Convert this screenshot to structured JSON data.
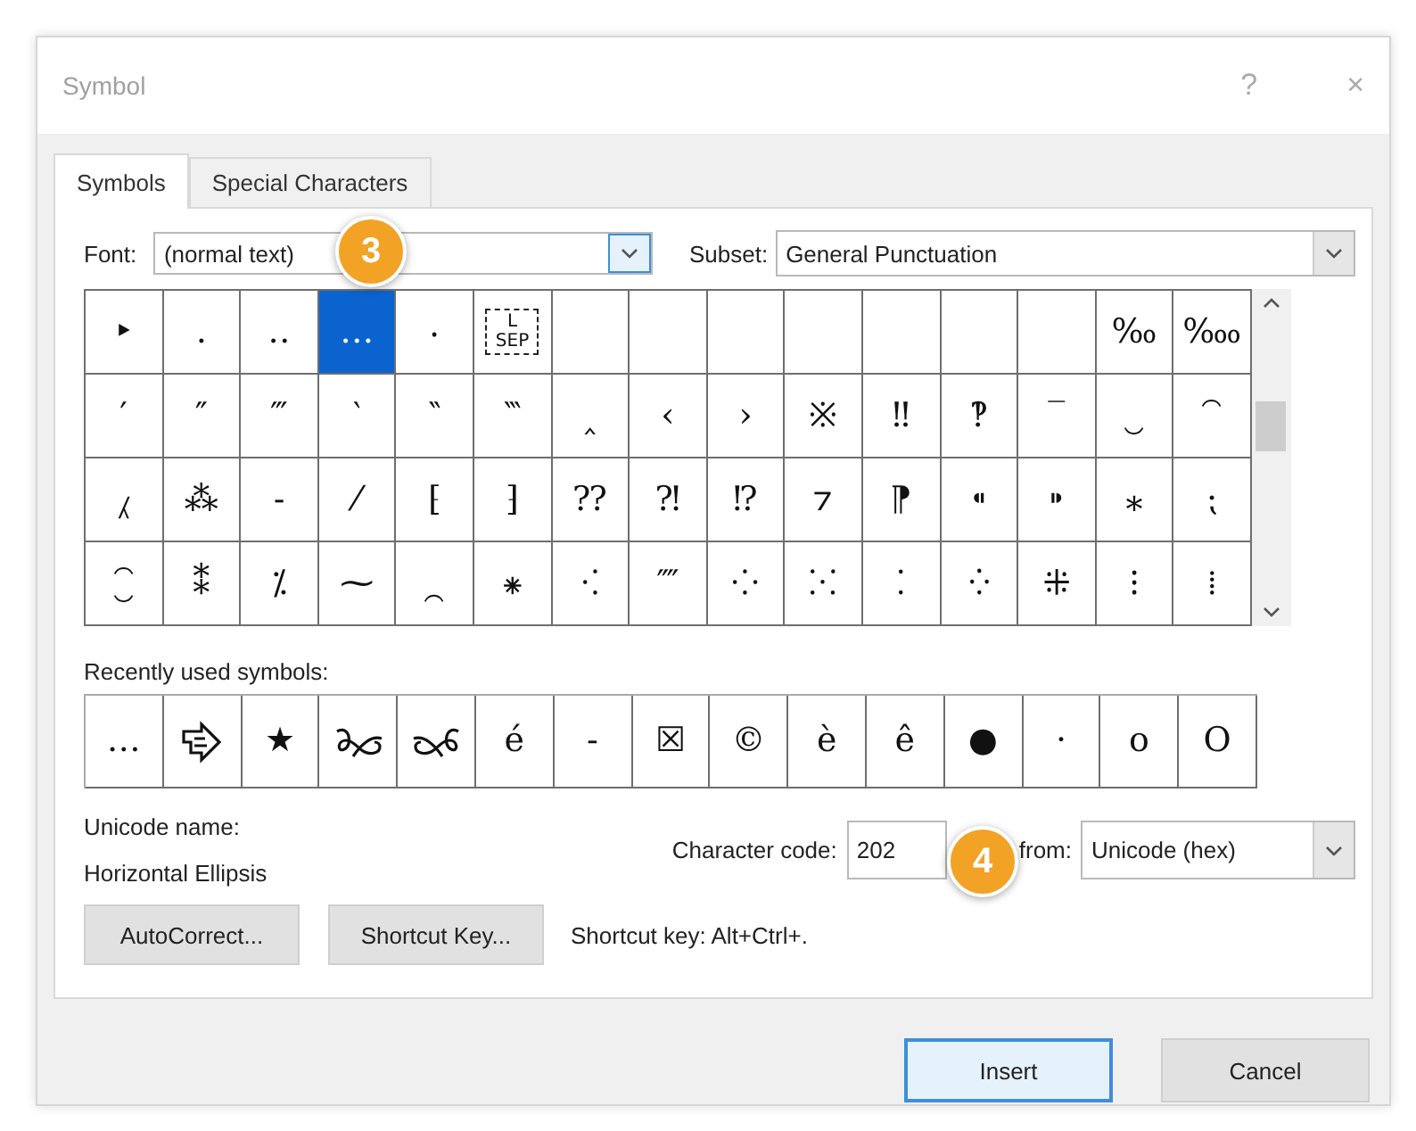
{
  "window": {
    "title": "Symbol",
    "help_button": "?",
    "close_button": "×"
  },
  "tabs": [
    {
      "label": "Symbols",
      "selected": true
    },
    {
      "label": "Special Characters",
      "selected": false
    }
  ],
  "font": {
    "label": "Font:",
    "value": "(normal text)"
  },
  "subset": {
    "label": "Subset:",
    "value": "General Punctuation"
  },
  "symbol_grid": {
    "rows": [
      [
        {
          "kind": "glyph",
          "char": "‣",
          "selected": false
        },
        {
          "kind": "glyph",
          "char": "․",
          "selected": false
        },
        {
          "kind": "glyph",
          "char": "‥",
          "selected": false
        },
        {
          "kind": "glyph",
          "char": "…",
          "selected": true
        },
        {
          "kind": "glyph",
          "char": "‧",
          "selected": false
        },
        {
          "kind": "control-picture",
          "char": "L SEP",
          "selected": false
        },
        {
          "kind": "blank",
          "selected": false
        },
        {
          "kind": "blank",
          "selected": false
        },
        {
          "kind": "blank",
          "selected": false
        },
        {
          "kind": "blank",
          "selected": false
        },
        {
          "kind": "blank",
          "selected": false
        },
        {
          "kind": "blank",
          "selected": false
        },
        {
          "kind": "blank",
          "selected": false
        },
        {
          "kind": "glyph",
          "char": "‰",
          "selected": false
        },
        {
          "kind": "glyph",
          "char": "‱",
          "selected": false
        }
      ],
      [
        {
          "kind": "glyph",
          "char": "′",
          "selected": false
        },
        {
          "kind": "glyph",
          "char": "″",
          "selected": false
        },
        {
          "kind": "glyph",
          "char": "‴",
          "selected": false
        },
        {
          "kind": "glyph",
          "char": "‵",
          "selected": false
        },
        {
          "kind": "glyph",
          "char": "‶",
          "selected": false
        },
        {
          "kind": "glyph",
          "char": "‷",
          "selected": false
        },
        {
          "kind": "glyph",
          "char": "‸",
          "selected": false
        },
        {
          "kind": "glyph",
          "char": "‹",
          "selected": false
        },
        {
          "kind": "glyph",
          "char": "›",
          "selected": false
        },
        {
          "kind": "glyph",
          "char": "※",
          "selected": false
        },
        {
          "kind": "glyph",
          "char": "‼",
          "selected": false
        },
        {
          "kind": "glyph",
          "char": "‽",
          "selected": false
        },
        {
          "kind": "glyph",
          "char": "‾",
          "selected": false
        },
        {
          "kind": "glyph",
          "char": "‿",
          "selected": false
        },
        {
          "kind": "glyph",
          "char": "⁀",
          "selected": false
        }
      ],
      [
        {
          "kind": "glyph",
          "char": "⁁",
          "selected": false
        },
        {
          "kind": "glyph",
          "char": "⁂",
          "selected": false
        },
        {
          "kind": "glyph",
          "char": "⁃",
          "selected": false
        },
        {
          "kind": "glyph",
          "char": "⁄",
          "selected": false
        },
        {
          "kind": "glyph",
          "char": "⁅",
          "selected": false
        },
        {
          "kind": "glyph",
          "char": "⁆",
          "selected": false
        },
        {
          "kind": "glyph",
          "char": "⁇",
          "selected": false
        },
        {
          "kind": "glyph",
          "char": "⁈",
          "selected": false
        },
        {
          "kind": "glyph",
          "char": "⁉",
          "selected": false
        },
        {
          "kind": "glyph",
          "char": "⁊",
          "selected": false
        },
        {
          "kind": "glyph",
          "char": "⁋",
          "selected": false
        },
        {
          "kind": "glyph",
          "char": "⁌",
          "selected": false
        },
        {
          "kind": "glyph",
          "char": "⁍",
          "selected": false
        },
        {
          "kind": "glyph",
          "char": "⁎",
          "selected": false
        },
        {
          "kind": "glyph",
          "char": "⁏",
          "selected": false
        }
      ],
      [
        {
          "kind": "glyph",
          "char": "⁐",
          "selected": false
        },
        {
          "kind": "glyph",
          "char": "⁑",
          "selected": false
        },
        {
          "kind": "glyph",
          "char": "⁒",
          "selected": false
        },
        {
          "kind": "glyph",
          "char": "⁓",
          "selected": false
        },
        {
          "kind": "glyph",
          "char": "⁔",
          "selected": false
        },
        {
          "kind": "glyph",
          "char": "⁕",
          "selected": false
        },
        {
          "kind": "glyph",
          "char": "⁖",
          "selected": false
        },
        {
          "kind": "glyph",
          "char": "⁗",
          "selected": false
        },
        {
          "kind": "glyph",
          "char": "⁘",
          "selected": false
        },
        {
          "kind": "glyph",
          "char": "⁙",
          "selected": false
        },
        {
          "kind": "glyph",
          "char": "⁚",
          "selected": false
        },
        {
          "kind": "glyph",
          "char": "⁛",
          "selected": false
        },
        {
          "kind": "glyph",
          "char": "⁜",
          "selected": false
        },
        {
          "kind": "glyph",
          "char": "⁝",
          "selected": false
        },
        {
          "kind": "glyph",
          "char": "⁞",
          "selected": false
        }
      ]
    ]
  },
  "recent": {
    "label": "Recently used symbols:",
    "items": [
      {
        "kind": "glyph",
        "char": "…",
        "selected": false
      },
      {
        "kind": "arrow-tag",
        "selected": false
      },
      {
        "kind": "glyph",
        "char": "★",
        "selected": false
      },
      {
        "kind": "ornament-left",
        "selected": false
      },
      {
        "kind": "ornament-right",
        "selected": false
      },
      {
        "kind": "glyph",
        "char": "é",
        "selected": false
      },
      {
        "kind": "glyph",
        "char": "-",
        "selected": false
      },
      {
        "kind": "glyph",
        "char": "☒",
        "selected": false
      },
      {
        "kind": "glyph",
        "char": "©",
        "selected": false
      },
      {
        "kind": "glyph",
        "char": "è",
        "selected": false
      },
      {
        "kind": "glyph",
        "char": "ê",
        "selected": false
      },
      {
        "kind": "glyph",
        "char": "●",
        "selected": false
      },
      {
        "kind": "glyph",
        "char": "·",
        "selected": false
      },
      {
        "kind": "glyph",
        "char": "o",
        "selected": false
      },
      {
        "kind": "glyph",
        "char": "O",
        "selected": false
      }
    ]
  },
  "unicode_name": {
    "label": "Unicode name:",
    "value": "Horizontal Ellipsis"
  },
  "character_code": {
    "label": "Character code:",
    "value": "202"
  },
  "from": {
    "label": "from:",
    "value": "Unicode (hex)"
  },
  "autocorrect_button": {
    "label": "AutoCorrect..."
  },
  "shortcut_key_button": {
    "label": "Shortcut Key..."
  },
  "shortcut_info": "Shortcut key: Alt+Ctrl+.",
  "dialog_buttons": [
    {
      "label": "Insert",
      "default": true
    },
    {
      "label": "Cancel",
      "default": false
    }
  ],
  "callouts": [
    {
      "label": "3"
    },
    {
      "label": "4"
    }
  ]
}
